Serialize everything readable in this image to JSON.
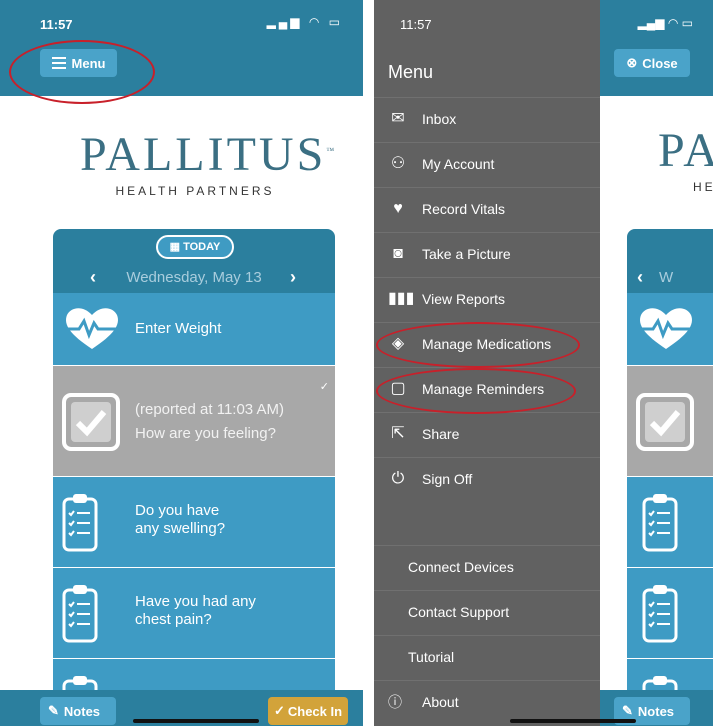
{
  "left": {
    "status": {
      "time": "11:57",
      "icons": "▂▄▆ ◠ ▭"
    },
    "menu_label": "Menu",
    "logo": {
      "name": "PALLITUS",
      "tm": "™",
      "sub": "HEALTH PARTNERS"
    },
    "today_label": "TODAY",
    "date": "Wednesday, May 13",
    "rows": [
      {
        "line1": "Enter Weight",
        "icon": "heart-pulse-icon"
      },
      {
        "line1": "(reported at 11:03 AM)",
        "line2": "How are you feeling?",
        "icon": "checkbox-icon"
      },
      {
        "line1": "Do you have",
        "line2": "any swelling?",
        "icon": "clipboard-icon"
      },
      {
        "line1": "Have you had any",
        "line2": "chest pain?",
        "icon": "clipboard-icon"
      },
      {
        "line1": "",
        "icon": "clipboard-icon"
      }
    ],
    "notes_label": "Notes",
    "checkin_label": "Check In"
  },
  "right": {
    "status": {
      "time": "11:57",
      "icons": "▂▄▆ ◠ ▭"
    },
    "drawer_title": "Menu",
    "close_label": "Close",
    "menu_items": [
      {
        "label": "Inbox",
        "icon": "envelope-icon"
      },
      {
        "label": "My Account",
        "icon": "user-icon"
      },
      {
        "label": "Record Vitals",
        "icon": "heart-pulse-icon"
      },
      {
        "label": "Take a Picture",
        "icon": "camera-icon"
      },
      {
        "label": "View Reports",
        "icon": "bar-chart-icon"
      },
      {
        "label": "Manage Medications",
        "icon": "pill-icon"
      },
      {
        "label": "Manage Reminders",
        "icon": "calendar-icon"
      },
      {
        "label": "Share",
        "icon": "share-icon"
      },
      {
        "label": "Sign Off",
        "icon": "power-icon"
      }
    ],
    "bottom_items": [
      {
        "label": "Connect Devices"
      },
      {
        "label": "Contact Support"
      },
      {
        "label": "Tutorial"
      },
      {
        "label": "About",
        "icon": "info-icon"
      }
    ],
    "peek": {
      "logo_fragment": "PA",
      "sub_fragment": "HE",
      "date_fragment": "W"
    },
    "notes_label": "Notes"
  },
  "colors": {
    "primary": "#2b7f9e",
    "button": "#4aa3c9",
    "row": "#3e9bc4",
    "row_done": "#a8a8a8",
    "drawer": "#616161",
    "checkin": "#d2a33a",
    "annotation": "#c8202a"
  }
}
